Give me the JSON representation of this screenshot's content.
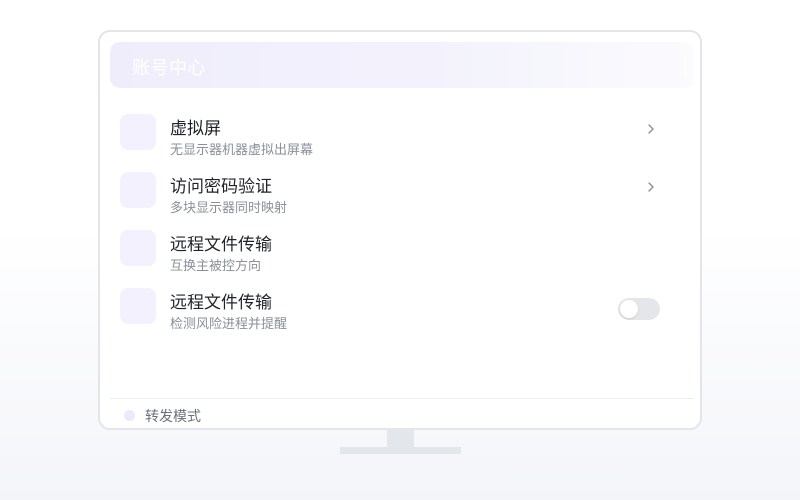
{
  "header": {
    "title": "账号中心"
  },
  "settings": [
    {
      "title": "虚拟屏",
      "subtitle": "无显示器机器虚拟出屏幕",
      "control": "chevron"
    },
    {
      "title": "访问密码验证",
      "subtitle": "多块显示器同时映射",
      "control": "chevron"
    },
    {
      "title": "远程文件传输",
      "subtitle": "互换主被控方向",
      "control": "none"
    },
    {
      "title": "远程文件传输",
      "subtitle": "检测风险进程并提醒",
      "control": "toggle",
      "toggle_on": false
    }
  ],
  "footer": {
    "label": "转发模式"
  },
  "icons": {
    "chevron": "chevron-right-icon",
    "row_icon": "settings-item-icon",
    "footer_dot": "status-dot-icon"
  },
  "colors": {
    "accent_light": "#f3f1fd",
    "text_primary": "#1f2329",
    "text_secondary": "#8a8f99",
    "toggle_off": "#e4e6ea"
  }
}
